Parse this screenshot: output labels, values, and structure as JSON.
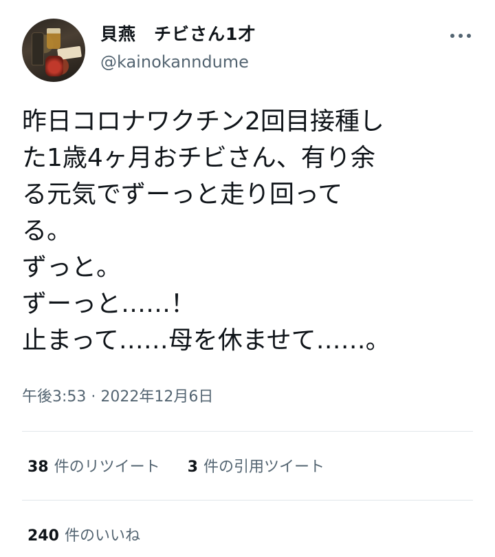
{
  "author": {
    "display_name": "貝燕　チビさん1才",
    "handle": "@kainokanndume"
  },
  "tweet": {
    "lines": [
      "昨日コロナワクチン2回目接種し",
      "た1歳4ヶ月おチビさん、有り余",
      "る元気でずーっと走り回って",
      "る。",
      "ずっと。",
      "ずーっと……！",
      "止まって……母を休ませて……。"
    ],
    "timestamp": "午後3:53 · 2022年12月6日"
  },
  "stats": {
    "retweets_count": "38",
    "retweets_label": "件のリツイート",
    "quotes_count": "3",
    "quotes_label": "件の引用ツイート",
    "likes_count": "240",
    "likes_label": "件のいいね"
  },
  "icons": {
    "more": "more-horizontal-icon"
  },
  "colors": {
    "text_primary": "#0f1419",
    "text_secondary": "#536471",
    "divider": "#e1e6ea"
  }
}
